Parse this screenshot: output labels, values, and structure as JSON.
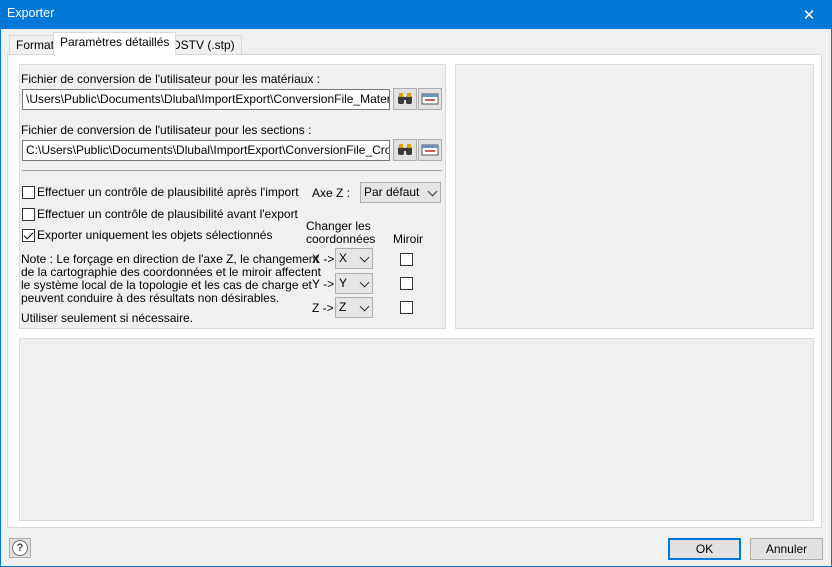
{
  "window": {
    "title": "Exporter"
  },
  "tabs": [
    {
      "label": "Format"
    },
    {
      "label": "Paramètres détaillés"
    },
    {
      "label": "DSTV (.stp)"
    }
  ],
  "materials": {
    "label": "Fichier de conversion de l'utilisateur pour les matériaux :",
    "value": "\\Users\\Public\\Documents\\Dlubal\\ImportExport\\ConversionFile_Material.txt"
  },
  "sections": {
    "label": "Fichier de conversion de l'utilisateur pour les sections :",
    "value": "C:\\Users\\Public\\Documents\\Dlubal\\ImportExport\\ConversionFile_CrossSect"
  },
  "options": {
    "check_import": {
      "label": "Effectuer un contrôle de plausibilité après l'import",
      "checked": false
    },
    "check_export": {
      "label": "Effectuer un contrôle de plausibilité avant l'export",
      "checked": false
    },
    "selected_only": {
      "label": "Exporter uniquement les objets sélectionnés",
      "checked": true
    }
  },
  "note": {
    "lines": [
      "Note : Le forçage en direction de l'axe Z, le changement",
      "de la cartographie des coordonnées et le miroir affectent",
      "le système local de la topologie et les cas de charge et",
      "peuvent conduire à des résultats non désirables."
    ],
    "caution": "Utiliser seulement si nécessaire."
  },
  "axis": {
    "label": "Axe Z :",
    "value": "Par défaut"
  },
  "coords": {
    "header_line1": "Changer les",
    "header_line2": "coordonnées",
    "mirror_header": "Miroir",
    "rows": [
      {
        "label": "X ->",
        "value": "X",
        "mirror": false
      },
      {
        "label": "Y ->",
        "value": "Y",
        "mirror": false
      },
      {
        "label": "Z ->",
        "value": "Z",
        "mirror": false
      }
    ]
  },
  "buttons": {
    "ok": "OK",
    "cancel": "Annuler"
  },
  "icons": {
    "close": "close-icon",
    "browse": "binoculars-icon",
    "edit": "edit-file-icon",
    "help": "help-icon"
  }
}
